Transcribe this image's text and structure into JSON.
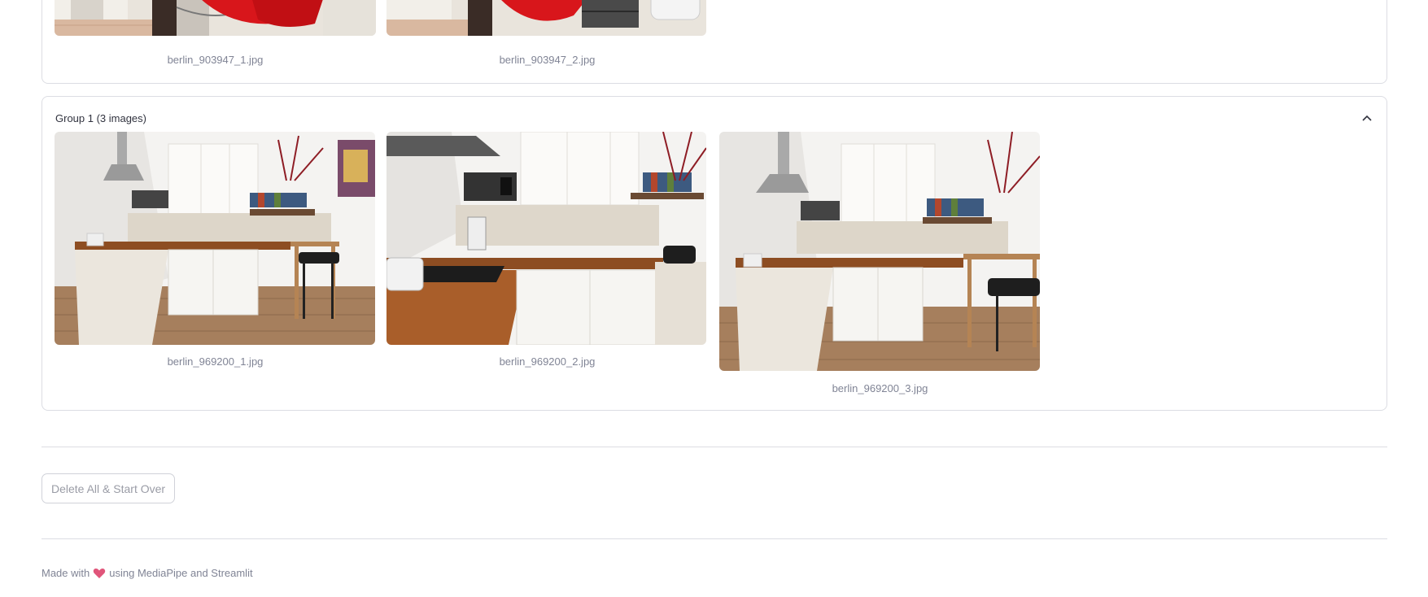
{
  "top_group": {
    "images": [
      {
        "filename": "berlin_903947_1.jpg"
      },
      {
        "filename": "berlin_903947_2.jpg"
      }
    ]
  },
  "group": {
    "title": "Group 1 (3 images)",
    "images": [
      {
        "filename": "berlin_969200_1.jpg"
      },
      {
        "filename": "berlin_969200_2.jpg"
      },
      {
        "filename": "berlin_969200_3.jpg"
      }
    ]
  },
  "actions": {
    "delete_label": "Delete All & Start Over"
  },
  "footer": {
    "prefix": "Made with",
    "suffix": "using MediaPipe and Streamlit",
    "heart_color": "#e0557a"
  }
}
